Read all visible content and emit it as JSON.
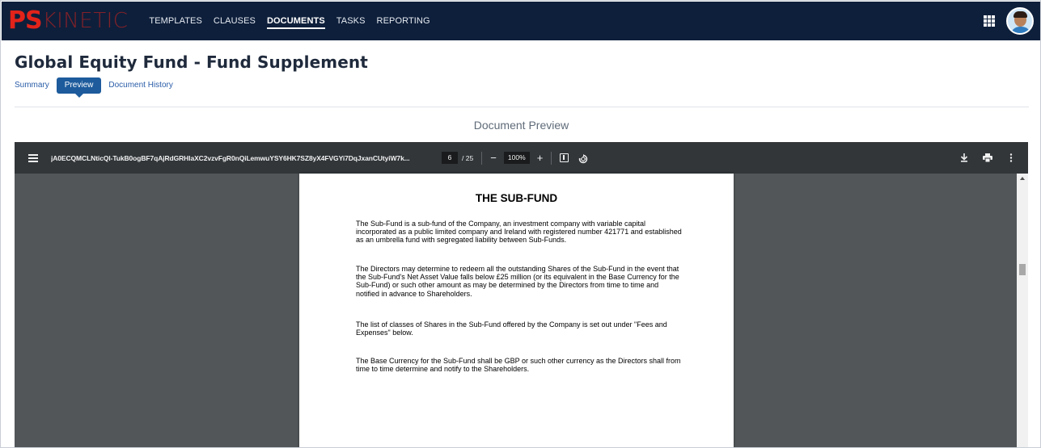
{
  "app": {
    "logo_ps": "PS",
    "logo_kinetic": "KINETIC"
  },
  "nav": {
    "items": [
      {
        "label": "TEMPLATES",
        "active": false
      },
      {
        "label": "CLAUSES",
        "active": false
      },
      {
        "label": "DOCUMENTS",
        "active": true
      },
      {
        "label": "TASKS",
        "active": false
      },
      {
        "label": "REPORTING",
        "active": false
      }
    ],
    "apps_icon": "grid-icon",
    "avatar_icon": "user-avatar"
  },
  "page": {
    "title": "Global Equity Fund - Fund Supplement",
    "tabs": [
      {
        "label": "Summary",
        "active": false
      },
      {
        "label": "Preview",
        "active": true
      },
      {
        "label": "Document History",
        "active": false
      }
    ],
    "section_heading": "Document Preview"
  },
  "viewer": {
    "document_name": "jA0ECQMCLNticQl-TukB0ogBF7qAjRdGRHlaXC2vzvFgR0nQiLemwuYSY6HK7SZ8yX4FVGYi7DqJxanCUtyiW7k...",
    "current_page": "6",
    "total_pages": "/ 25",
    "zoom": "100%",
    "zoom_out_label": "−",
    "zoom_in_label": "+",
    "icons": [
      "menu-icon",
      "fit-page-icon",
      "rotate-icon",
      "download-icon",
      "print-icon",
      "more-icon"
    ]
  },
  "document": {
    "heading": "THE SUB-FUND",
    "paragraphs": [
      "The Sub-Fund is a sub-fund of the Company, an investment company with variable capital incorporated as a public limited company and Ireland with registered number 421771 and established as an umbrella fund with segregated liability between Sub-Funds.",
      "The Directors may determine to redeem all the outstanding Shares of the Sub-Fund in the event that the Sub-Fund's Net Asset Value falls below £25 million (or its equivalent in the Base Currency for the Sub-Fund) or such other amount as may be determined by the Directors from time to time and notified in advance to Shareholders.",
      "The list of classes of Shares in the Sub-Fund offered by the Company is set out under \"Fees and Expenses\" below.",
      "The Base Currency for the Sub-Fund shall be GBP or such other currency as the Directors shall from time to time determine and notify to the Shareholders."
    ]
  }
}
